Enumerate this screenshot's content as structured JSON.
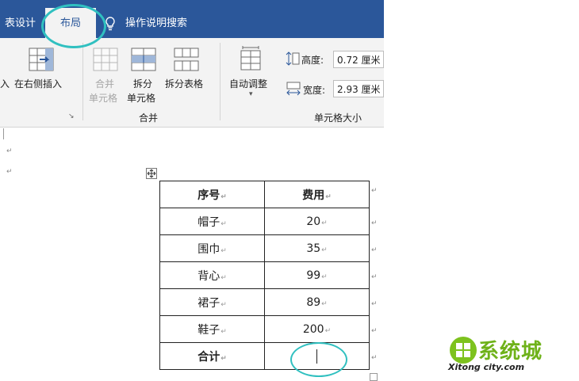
{
  "tabs": {
    "table_design": "表设计",
    "layout": "布局",
    "search": "操作说明搜索"
  },
  "ribbon": {
    "insert_left_partial": "入",
    "insert_right": "在右侧插入",
    "merge_cells_line1": "合并",
    "merge_cells_line2": "单元格",
    "split_cells_line1": "拆分",
    "split_cells_line2": "单元格",
    "split_table": "拆分表格",
    "merge_group": "合并",
    "autofit": "自动调整",
    "height_label": "高度:",
    "height_value": "0.72 厘米",
    "width_label": "宽度:",
    "width_value": "2.93 厘米",
    "cell_size_group": "单元格大小"
  },
  "table": {
    "header": [
      "序号",
      "费用"
    ],
    "rows": [
      [
        "帽子",
        "20"
      ],
      [
        "围巾",
        "35"
      ],
      [
        "背心",
        "99"
      ],
      [
        "裙子",
        "89"
      ],
      [
        "鞋子",
        "200"
      ]
    ],
    "total_label": "合计",
    "total_value": ""
  },
  "watermark": {
    "line1": "系统城",
    "line2": "Xitong city.com"
  },
  "colors": {
    "ribbon_blue": "#2b579a",
    "ribbon_bg": "#f3f3f3",
    "highlight": "#30c0c0"
  }
}
